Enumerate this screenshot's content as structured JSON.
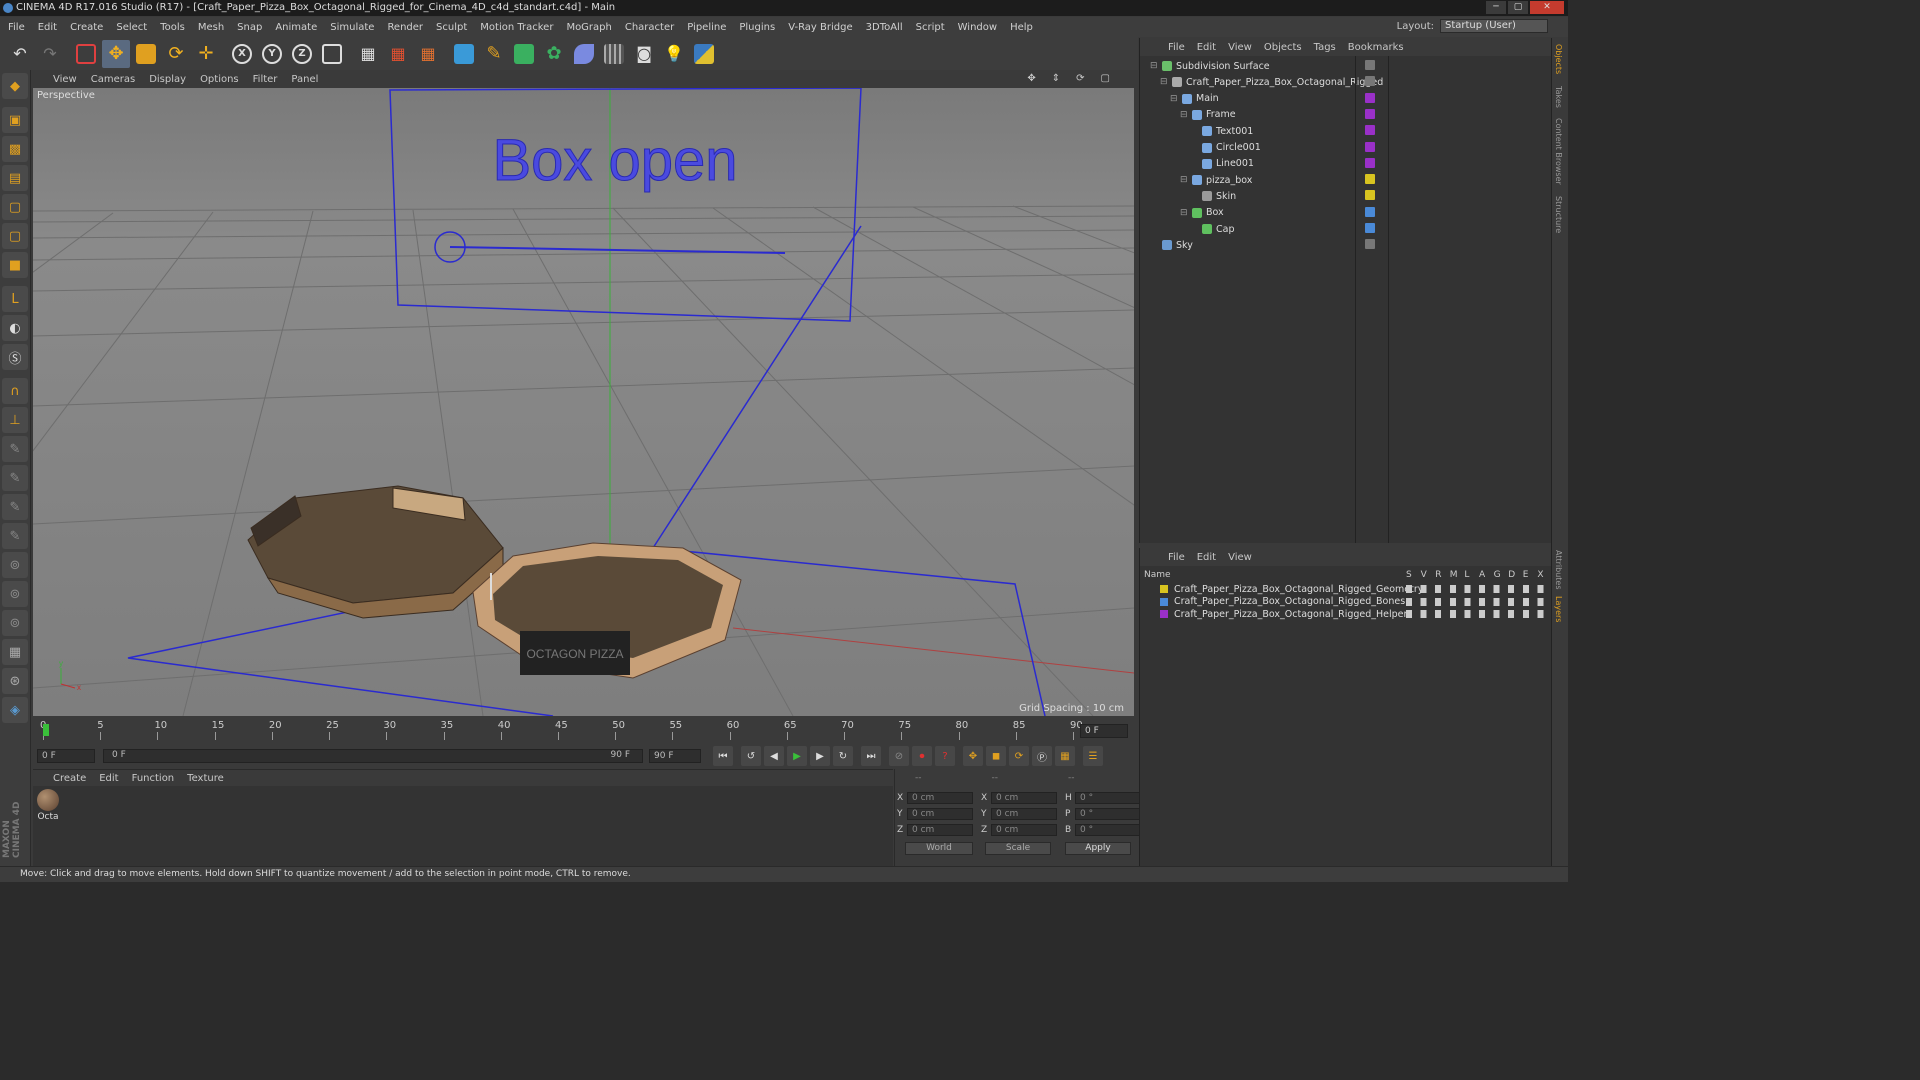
{
  "window": {
    "title": "CINEMA 4D R17.016 Studio (R17) - [Craft_Paper_Pizza_Box_Octagonal_Rigged_for_Cinema_4D_c4d_standart.c4d] - Main"
  },
  "menu": [
    "File",
    "Edit",
    "Create",
    "Select",
    "Tools",
    "Mesh",
    "Snap",
    "Animate",
    "Simulate",
    "Render",
    "Sculpt",
    "Motion Tracker",
    "MoGraph",
    "Character",
    "Pipeline",
    "Plugins",
    "V-Ray Bridge",
    "3DToAll",
    "Script",
    "Window",
    "Help"
  ],
  "layout": {
    "label": "Layout:",
    "value": "Startup (User)"
  },
  "viewport": {
    "menu": [
      "View",
      "Cameras",
      "Display",
      "Options",
      "Filter",
      "Panel"
    ],
    "label": "Perspective",
    "grid_spacing": "Grid Spacing : 10 cm",
    "scene_text": "Box open",
    "box_label": "OCTAGON PIZZA"
  },
  "timeline": {
    "ticks": [
      "0",
      "5",
      "10",
      "15",
      "20",
      "25",
      "30",
      "35",
      "40",
      "45",
      "50",
      "55",
      "60",
      "65",
      "70",
      "75",
      "80",
      "85",
      "90"
    ],
    "current_frame": "0 F",
    "start": "0 F",
    "range_start": "0 F",
    "range_end": "90 F",
    "end": "90 F"
  },
  "material_menu": [
    "Create",
    "Edit",
    "Function",
    "Texture"
  ],
  "material": {
    "name": "Octa"
  },
  "coords": {
    "header": [
      "--",
      "--",
      "--"
    ],
    "rows": [
      {
        "a": "X",
        "av": "0 cm",
        "b": "X",
        "bv": "0 cm",
        "c": "H",
        "cv": "0 °"
      },
      {
        "a": "Y",
        "av": "0 cm",
        "b": "Y",
        "bv": "0 cm",
        "c": "P",
        "cv": "0 °"
      },
      {
        "a": "Z",
        "av": "0 cm",
        "b": "Z",
        "bv": "0 cm",
        "c": "B",
        "cv": "0 °"
      }
    ],
    "mode1": "World",
    "mode2": "Scale",
    "apply": "Apply"
  },
  "objects_menu": [
    "File",
    "Edit",
    "View",
    "Objects",
    "Tags",
    "Bookmarks"
  ],
  "objects": [
    {
      "name": "Subdivision Surface",
      "indent": 0,
      "color": "#6abf6a"
    },
    {
      "name": "Craft_Paper_Pizza_Box_Octagonal_Rigged",
      "indent": 1,
      "color": "#aaaaaa"
    },
    {
      "name": "Main",
      "indent": 2,
      "color": "#7aa8e0"
    },
    {
      "name": "Frame",
      "indent": 3,
      "color": "#7aa8e0"
    },
    {
      "name": "Text001",
      "indent": 4,
      "color": "#7aa8e0"
    },
    {
      "name": "Circle001",
      "indent": 4,
      "color": "#7aa8e0"
    },
    {
      "name": "Line001",
      "indent": 4,
      "color": "#7aa8e0"
    },
    {
      "name": "pizza_box",
      "indent": 3,
      "color": "#7aa8e0"
    },
    {
      "name": "Skin",
      "indent": 4,
      "color": "#9a9a9a"
    },
    {
      "name": "Box",
      "indent": 3,
      "color": "#5fc05f"
    },
    {
      "name": "Cap",
      "indent": 4,
      "color": "#5fc05f"
    },
    {
      "name": "Sky",
      "indent": 0,
      "color": "#6a9ad0"
    }
  ],
  "layers_menu": [
    "File",
    "Edit",
    "View"
  ],
  "layer_headers": [
    "Name",
    "S",
    "V",
    "R",
    "M",
    "L",
    "A",
    "G",
    "D",
    "E",
    "X"
  ],
  "layers": [
    {
      "name": "Craft_Paper_Pizza_Box_Octagonal_Rigged_Geometry",
      "color": "#d8c420"
    },
    {
      "name": "Craft_Paper_Pizza_Box_Octagonal_Rigged_Bones",
      "color": "#4a8ad8"
    },
    {
      "name": "Craft_Paper_Pizza_Box_Octagonal_Rigged_Helpers",
      "color": "#9a30c8"
    }
  ],
  "right_tabs": [
    "Objects",
    "Takes",
    "Content Browser",
    "Structure",
    "Attributes",
    "Layers"
  ],
  "brand": "MAXON CINEMA 4D",
  "status": "Move: Click and drag to move elements. Hold down SHIFT to quantize movement / add to the selection in point mode, CTRL to remove."
}
